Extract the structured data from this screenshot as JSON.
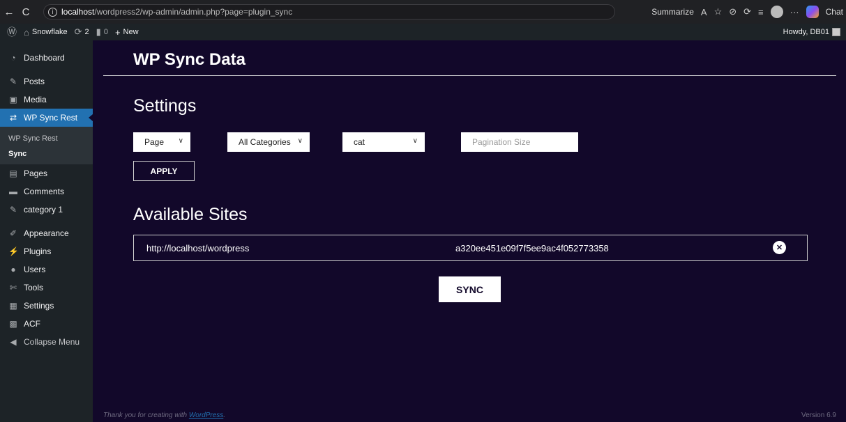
{
  "browser": {
    "back_icon": "←",
    "reload_icon": "C",
    "url_host": "localhost",
    "url_path": "/wordpress2/wp-admin/admin.php?page=plugin_sync",
    "summarize_label": "Summarize",
    "chat_label": "Chat"
  },
  "admin_bar": {
    "site_name": "Snowflake",
    "updates_count": "2",
    "comments_count": "0",
    "new_label": "New",
    "howdy": "Howdy, DB01"
  },
  "sidebar": {
    "items": [
      {
        "label": "Dashboard",
        "icon": "dashboard-icon"
      },
      {
        "label": "Posts",
        "icon": "pin-icon"
      },
      {
        "label": "Media",
        "icon": "media-icon"
      },
      {
        "label": "WP Sync Rest",
        "icon": "sync-icon"
      },
      {
        "label": "Pages",
        "icon": "page-icon"
      },
      {
        "label": "Comments",
        "icon": "comment-icon"
      },
      {
        "label": "category 1",
        "icon": "pin-icon"
      },
      {
        "label": "Appearance",
        "icon": "brush-icon"
      },
      {
        "label": "Plugins",
        "icon": "plugin-icon"
      },
      {
        "label": "Users",
        "icon": "user-icon"
      },
      {
        "label": "Tools",
        "icon": "wrench-icon"
      },
      {
        "label": "Settings",
        "icon": "settings-icon"
      },
      {
        "label": "ACF",
        "icon": "acf-icon"
      },
      {
        "label": "Collapse Menu",
        "icon": "collapse-icon"
      }
    ],
    "submenu": [
      {
        "label": "WP Sync Rest"
      },
      {
        "label": "Sync"
      }
    ]
  },
  "main": {
    "title": "WP Sync Data",
    "settings_heading": "Settings",
    "filters": {
      "type_selected": "Page",
      "category_selected": "All Categories",
      "taxonomy_selected": "cat",
      "pagination_placeholder": "Pagination Size"
    },
    "apply_label": "APPLY",
    "sites_heading": "Available Sites",
    "sites": [
      {
        "url": "http://localhost/wordpress",
        "key": "a320ee451e09f7f5ee9ac4f052773358"
      }
    ],
    "sync_label": "SYNC"
  },
  "footer": {
    "thanks_prefix": "Thank you for creating with ",
    "wordpress_link": "WordPress",
    "thanks_suffix": ".",
    "version": "Version 6.9"
  }
}
